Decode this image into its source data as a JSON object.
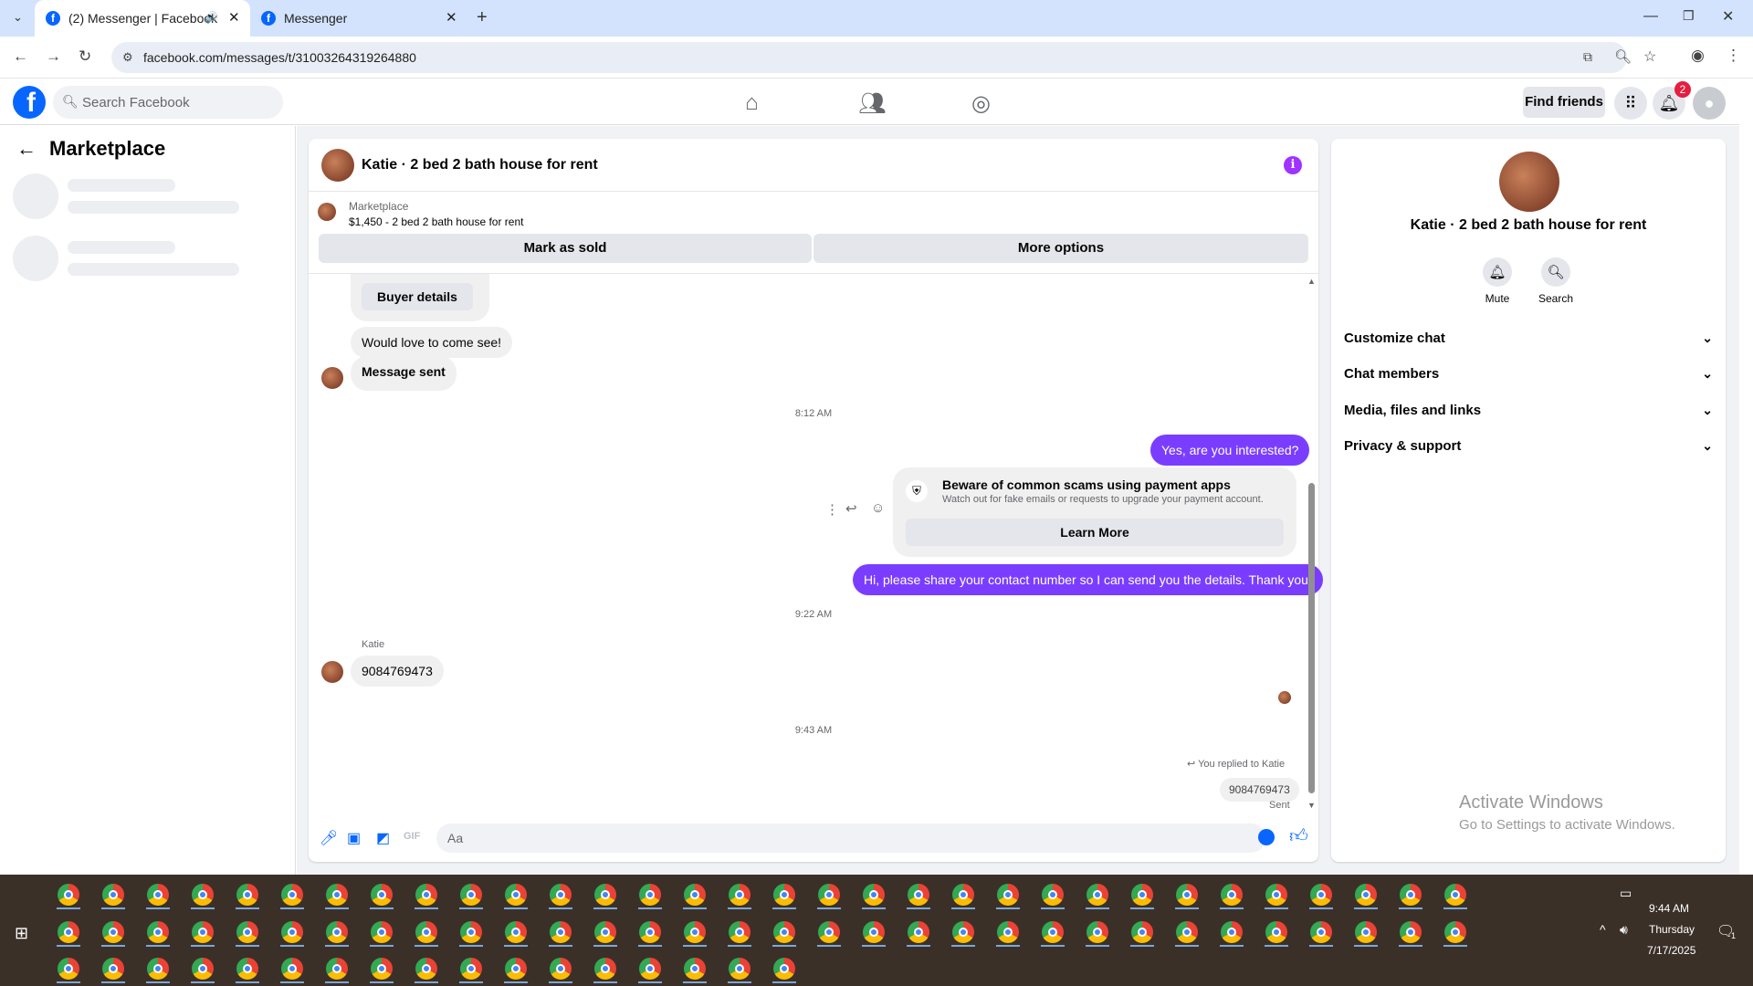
{
  "browser": {
    "tabs": [
      {
        "title": "(2) Messenger | Facebook",
        "active": true
      },
      {
        "title": "Messenger",
        "active": false
      }
    ],
    "url": "facebook.com/messages/t/31003264319264880"
  },
  "fb_header": {
    "logo": "f",
    "search_placeholder": "Search Facebook",
    "find_friends": "Find friends",
    "notification_count": "2",
    "icons": [
      "home-icon",
      "friends-icon",
      "groups-icon",
      "grid-menu-icon",
      "bell-icon",
      "profile-avatar"
    ]
  },
  "left_panel": {
    "title": "Marketplace"
  },
  "chat": {
    "title": "Katie · 2 bed 2 bath house for rent",
    "marketplace": {
      "label": "Marketplace",
      "listing": "$1,450 - 2 bed 2 bath house for rent",
      "mark_sold": "Mark as sold",
      "more_options": "More options"
    },
    "buyer_details": "Buyer details",
    "messages": {
      "m1": "Would love to come see!",
      "m2": "Message sent",
      "ts1": "8:12 AM",
      "m3": "Yes, are you interested?",
      "scam_title": "Beware of common scams using payment apps",
      "scam_sub": "Watch out for fake emails or requests to upgrade your payment account.",
      "learn_more": "Learn More",
      "m4": "Hi, please share your contact number so I can send you the details. Thank you!",
      "ts2": "9:22 AM",
      "sender_name": "Katie",
      "m5": "9084769473",
      "ts3": "9:43 AM",
      "replied": "You replied to Katie",
      "m6": "9084769473",
      "status": "Sent"
    },
    "composer_placeholder": "Aa"
  },
  "right_panel": {
    "name": "Katie · 2 bed 2 bath house for rent",
    "actions": [
      "Mute",
      "Search"
    ],
    "sections": [
      "Customize chat",
      "Chat members",
      "Media, files and links",
      "Privacy & support"
    ]
  },
  "watermark": {
    "line1": "Activate Windows",
    "line2": "Go to Settings to activate Windows."
  },
  "taskbar": {
    "time": "9:44 AM",
    "day": "Thursday",
    "date": "7/17/2025",
    "notif": "1"
  }
}
